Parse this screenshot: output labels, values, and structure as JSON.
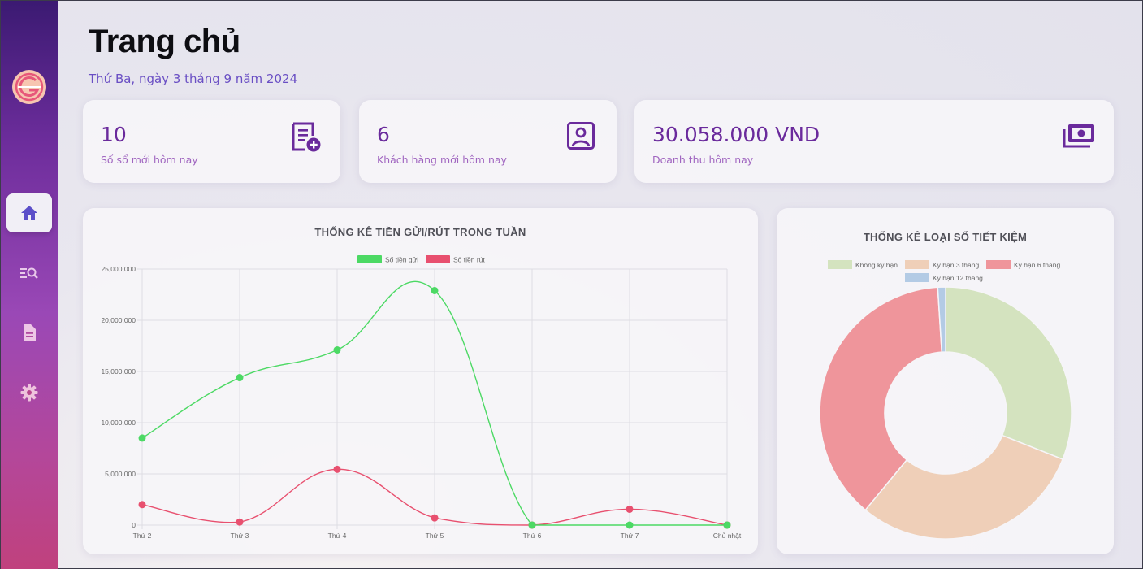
{
  "header": {
    "title": "Trang chủ",
    "date": "Thứ Ba, ngày 3 tháng 9 năm 2024"
  },
  "sidebar": {
    "items": [
      {
        "icon": "home-icon",
        "active": true
      },
      {
        "icon": "search-list-icon",
        "active": false
      },
      {
        "icon": "document-icon",
        "active": false
      },
      {
        "icon": "settings-icon",
        "active": false
      }
    ]
  },
  "stats": [
    {
      "value": "10",
      "label": "Số sổ mới hôm nay",
      "icon": "document-add-icon"
    },
    {
      "value": "6",
      "label": "Khách hàng mới hôm nay",
      "icon": "user-card-icon"
    },
    {
      "value": "30.058.000 VND",
      "label": "Doanh thu hôm nay",
      "icon": "money-icon"
    }
  ],
  "colors": {
    "accent": "#6a2a9c",
    "deposit": "#4cd964",
    "withdraw": "#e8506f",
    "pie": [
      "#d4e3bf",
      "#efcfb8",
      "#ef959b",
      "#b3cbe5"
    ]
  },
  "chart_data": [
    {
      "type": "line",
      "title": "THỐNG KÊ TIỀN GỬI/RÚT TRONG TUẦN",
      "categories": [
        "Thứ 2",
        "Thứ 3",
        "Thứ 4",
        "Thứ 5",
        "Thứ 6",
        "Thứ 7",
        "Chủ nhật"
      ],
      "series": [
        {
          "name": "Số tiền gửi",
          "color": "#4cd964",
          "values": [
            8500000,
            14400000,
            17100000,
            22900000,
            0,
            0,
            0
          ]
        },
        {
          "name": "Số tiền rút",
          "color": "#e8506f",
          "values": [
            2000000,
            300000,
            5450000,
            700000,
            0,
            1550000,
            0
          ]
        }
      ],
      "ylim": [
        0,
        25000000
      ],
      "yticks": [
        "0",
        "5,000,000",
        "10,000,000",
        "15,000,000",
        "20,000,000",
        "25,000,000"
      ],
      "grid": true,
      "legend": "top"
    },
    {
      "type": "pie",
      "title": "THỐNG KÊ LOẠI SỔ TIẾT KIỆM",
      "categories": [
        "Không kỳ hạn",
        "Kỳ hạn 3 tháng",
        "Kỳ hạn 6 tháng",
        "Kỳ hạn 12 tháng"
      ],
      "values": [
        31,
        30,
        38,
        1
      ],
      "legend": "top"
    }
  ]
}
